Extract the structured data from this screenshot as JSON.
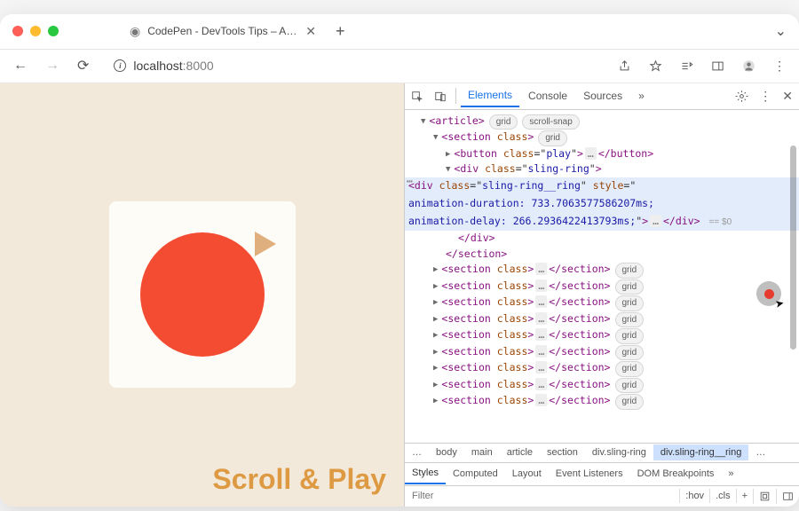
{
  "window": {
    "tab_title": "CodePen - DevTools Tips – Ani…",
    "new_tab_glyph": "+",
    "expand_glyph": "⌄"
  },
  "toolbar": {
    "back": "←",
    "forward": "→",
    "reload": "⟳",
    "host": "localhost",
    "path": ":8000"
  },
  "page": {
    "hero": "Scroll & Play"
  },
  "devtools": {
    "tabs": {
      "elements": "Elements",
      "console": "Console",
      "sources": "Sources",
      "more": "»"
    },
    "dom": {
      "article_open": "<article>",
      "article_badge1": "grid",
      "article_badge2": "scroll-snap",
      "section_open": "<section class>",
      "section_badge": "grid",
      "button_line": "<button class=\"play\">…</button>",
      "div_sling_open": "<div class=\"sling-ring\">",
      "sling_ring_open": "<div class=\"sling-ring__ring\" style=\"",
      "anim_dur": "animation-duration: 733.7063577586207ms;",
      "anim_delay": "animation-delay: 266.2936422413793ms;\">…</div>",
      "dim_eq": "== $0",
      "div_close": "</div>",
      "section_close": "</section>",
      "section_collapsed": "<section class>…</section>"
    },
    "breadcrumb": [
      "…",
      "body",
      "main",
      "article",
      "section",
      "div.sling-ring",
      "div.sling-ring__ring",
      "…"
    ],
    "styles": {
      "t1": "Styles",
      "t2": "Computed",
      "t3": "Layout",
      "t4": "Event Listeners",
      "t5": "DOM Breakpoints",
      "more": "»"
    },
    "filter": {
      "placeholder": "Filter",
      "hov": ":hov",
      "cls": ".cls",
      "plus": "+"
    }
  }
}
